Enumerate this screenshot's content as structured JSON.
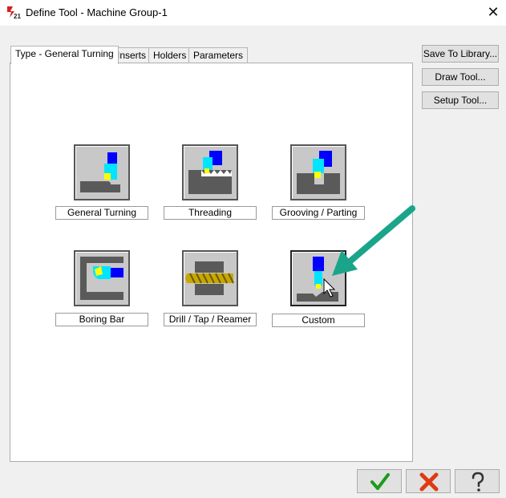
{
  "window": {
    "title": "Define Tool - Machine Group-1",
    "app_icon": "mastercam-2021-icon",
    "close_glyph": "✕"
  },
  "tabs": [
    {
      "label": "Type - General Turning",
      "active": true
    },
    {
      "label": "Inserts",
      "active": false
    },
    {
      "label": "Holders",
      "active": false
    },
    {
      "label": "Parameters",
      "active": false
    }
  ],
  "side_buttons": {
    "save_to_library": "Save To Library...",
    "draw_tool": "Draw Tool...",
    "setup_tool": "Setup Tool..."
  },
  "tool_types": [
    {
      "label": "General Turning",
      "icon": "general-turning-icon"
    },
    {
      "label": "Threading",
      "icon": "threading-icon"
    },
    {
      "label": "Grooving / Parting",
      "icon": "grooving-parting-icon"
    },
    {
      "label": "Boring Bar",
      "icon": "boring-bar-icon"
    },
    {
      "label": "Drill / Tap / Reamer",
      "icon": "drill-tap-reamer-icon"
    },
    {
      "label": "Custom",
      "icon": "custom-icon",
      "selected": true
    }
  ],
  "bottom_buttons": {
    "ok": "ok-checkmark-icon",
    "cancel": "cancel-x-icon",
    "help": "help-question-icon"
  },
  "colors": {
    "tool_blue": "#0000ff",
    "tool_cyan": "#00e5ff",
    "insert_yellow": "#ffff00",
    "part_gray": "#5a5a5a",
    "annotation_arrow": "#1aa58a",
    "ok_green": "#1e9b1e",
    "cancel_red": "#e03a10"
  }
}
